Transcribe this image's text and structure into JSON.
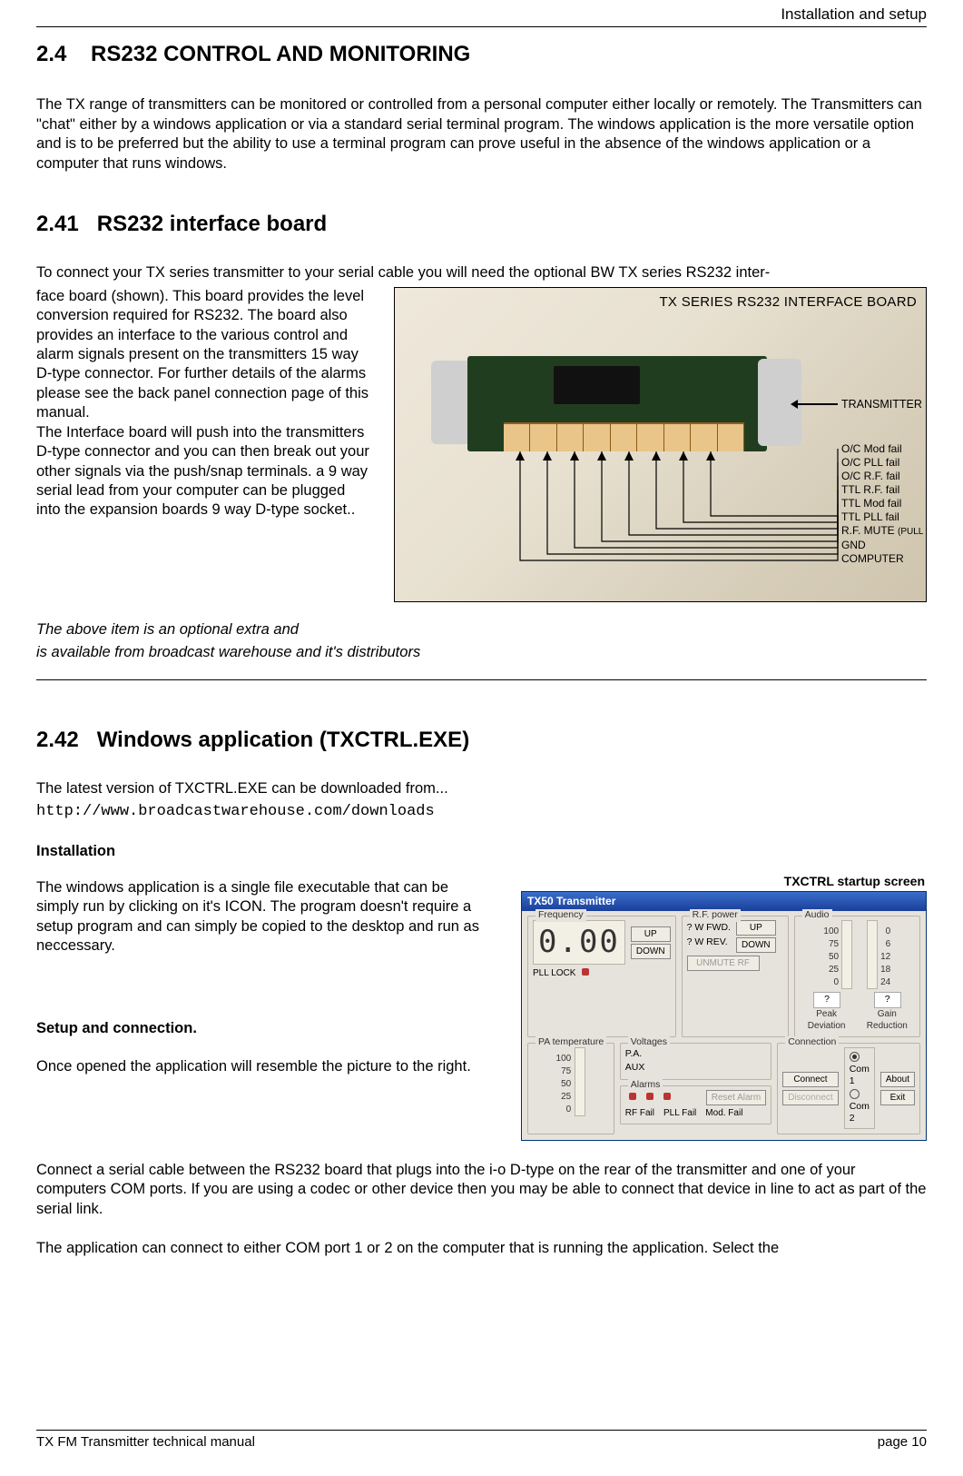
{
  "header": {
    "right": "Installation and setup"
  },
  "sec24": {
    "num": "2.4",
    "title": "RS232 CONTROL AND MONITORING",
    "para": "The TX range of transmitters can be monitored or controlled from a personal computer either locally or remotely. The Transmitters can \"chat\" either by a windows application or via a standard serial terminal program. The windows application is the more versatile option and is to be preferred but the ability to use a terminal program can prove useful in the absence of the windows application or a computer that runs windows."
  },
  "sec241": {
    "num": "2.41",
    "title": "RS232 interface board",
    "lead": "To connect your TX series transmitter to your serial cable you will need the optional BW TX series RS232 inter-",
    "body": "face board (shown). This board provides the level conversion required for RS232. The board also provides an interface to the various control and alarm signals present on the transmitters 15 way D-type connector. For further details of the alarms please see the back panel connection page of this manual.\nThe Interface board will push into the transmitters D-type connector and you can then break out your other signals via the push/snap terminals. a 9 way serial lead from your computer can be plugged into the expansion boards 9 way D-type socket..",
    "note1": "The above item is an optional extra and",
    "note2": "is available from broadcast warehouse and it's distributors"
  },
  "ifb": {
    "title": "TX SERIES RS232 INTERFACE BOARD",
    "tx": "TRANSMITTER",
    "signals": [
      "O/C Mod fail",
      "O/C PLL fail",
      "O/C R.F. fail",
      "TTL R.F. fail",
      "TTL Mod fail",
      "TTL PLL fail"
    ],
    "mute": "R.F. MUTE ",
    "mute_small": "(PULL LOW FOR MUTE)",
    "gnd": "GND",
    "computer": "COMPUTER"
  },
  "sec242": {
    "num": "2.42",
    "title": "Windows application (TXCTRL.EXE)",
    "p1": "The latest version of TXCTRL.EXE can be downloaded from...",
    "url": "http://www.broadcastwarehouse.com/downloads",
    "h_install": "Installation",
    "p_install": "The windows application is a single file executable that can be simply run by clicking on it's ICON. The program doesn't require a setup program and can simply be copied to the desktop and run as neccessary.",
    "h_setup": "Setup and connection.",
    "p_setup": "Once opened the application will resemble the picture to the right.",
    "p_conn": "Connect a serial cable between the RS232 board that plugs into the i-o D-type on the rear of the transmitter and one of your computers COM ports. If you are using a codec or other device then you may be able to connect that device in line to act as part of the serial link.",
    "p_com": "The application can connect to either COM port 1 or 2 on the computer that is running the application. Select the"
  },
  "txctrl": {
    "caption": "TXCTRL startup screen",
    "title": "TX50 Transmitter",
    "freq": {
      "label": "Frequency",
      "value": "0.00",
      "up": "UP",
      "down": "DOWN",
      "lock": "PLL LOCK"
    },
    "rf": {
      "label": "R.F. power",
      "fwd": "? W FWD.",
      "rev": "? W REV.",
      "up": "UP",
      "down": "DOWN",
      "unmute": "UNMUTE RF"
    },
    "audio": {
      "label": "Audio",
      "left_scale": [
        "0",
        "25",
        "50",
        "75",
        "100"
      ],
      "right_scale": [
        "24",
        "18",
        "12",
        "6",
        "0"
      ],
      "peak": "Peak Deviation",
      "gain": "Gain Reduction",
      "q": "?"
    },
    "pa": {
      "label": "PA temperature",
      "scale": [
        "0",
        "25",
        "50",
        "75",
        "100"
      ]
    },
    "volt": {
      "label": "Voltages",
      "pa": "P.A.",
      "aux": "AUX"
    },
    "alarms": {
      "label": "Alarms",
      "reset": "Reset Alarm",
      "rf": "RF Fail",
      "pll": "PLL Fail",
      "mod": "Mod. Fail"
    },
    "conn": {
      "label": "Connection",
      "connect": "Connect",
      "disconnect": "Disconnect",
      "com1": "Com 1",
      "com2": "Com 2",
      "about": "About",
      "exit": "Exit"
    }
  },
  "footer": {
    "left": "TX FM Transmitter technical manual",
    "right": "page 10"
  }
}
